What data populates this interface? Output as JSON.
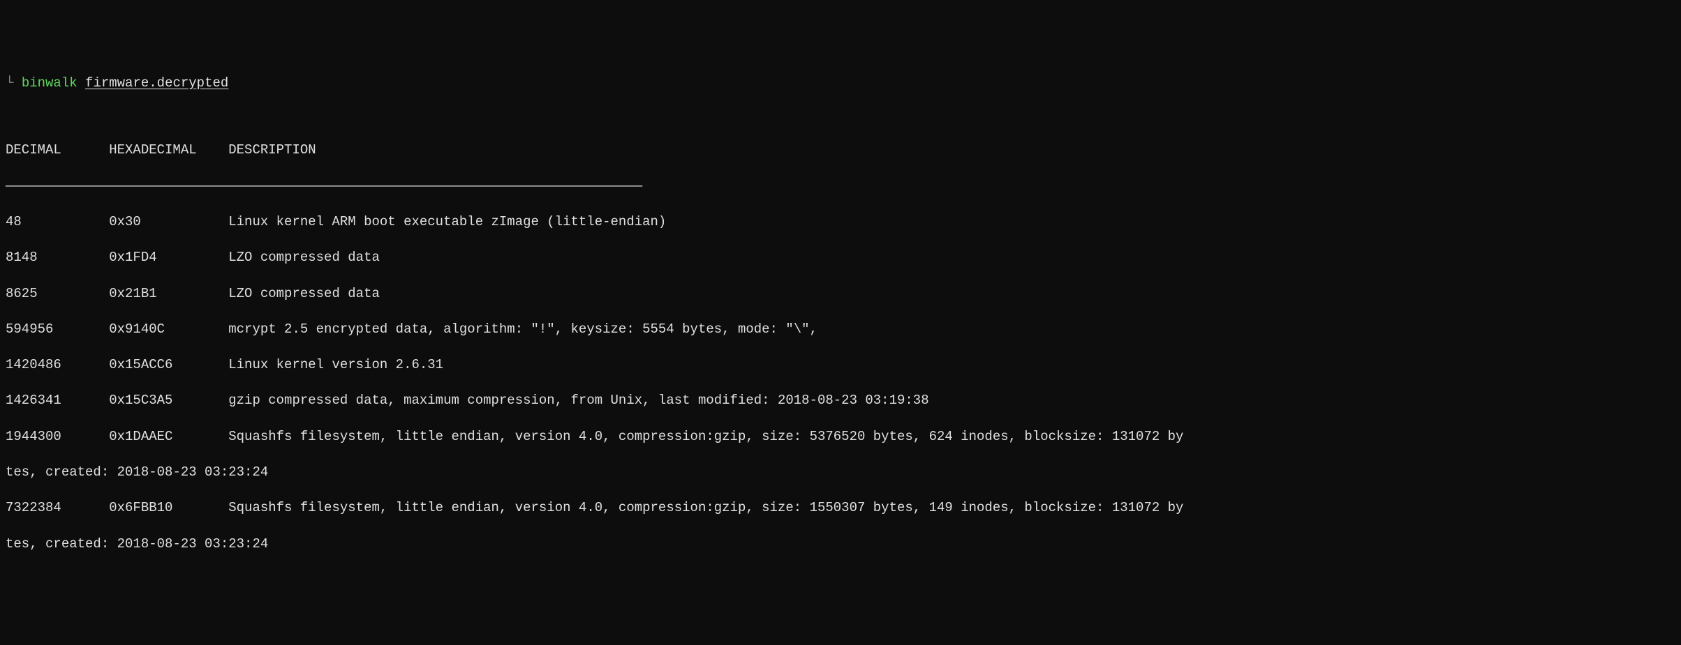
{
  "prompt": {
    "char": "└",
    "command": "binwalk",
    "argument": "firmware.decrypted"
  },
  "headers": {
    "decimal": "DECIMAL",
    "hexadecimal": "HEXADECIMAL",
    "description": "DESCRIPTION"
  },
  "separator": "————————————————————————————————————————————————————————————————————————————————",
  "rows": [
    {
      "decimal": "48",
      "hex": "0x30",
      "description": "Linux kernel ARM boot executable zImage (little-endian)"
    },
    {
      "decimal": "8148",
      "hex": "0x1FD4",
      "description": "LZO compressed data"
    },
    {
      "decimal": "8625",
      "hex": "0x21B1",
      "description": "LZO compressed data"
    },
    {
      "decimal": "594956",
      "hex": "0x9140C",
      "description": "mcrypt 2.5 encrypted data, algorithm: \"!\", keysize: 5554 bytes, mode: \"\\\","
    },
    {
      "decimal": "1420486",
      "hex": "0x15ACC6",
      "description": "Linux kernel version 2.6.31"
    },
    {
      "decimal": "1426341",
      "hex": "0x15C3A5",
      "description": "gzip compressed data, maximum compression, from Unix, last modified: 2018-08-23 03:19:38"
    },
    {
      "decimal": "1944300",
      "hex": "0x1DAAEC",
      "description": "Squashfs filesystem, little endian, version 4.0, compression:gzip, size: 5376520 bytes, 624 inodes, blocksize: 131072 by",
      "continuation": "tes, created: 2018-08-23 03:23:24"
    },
    {
      "decimal": "7322384",
      "hex": "0x6FBB10",
      "description": "Squashfs filesystem, little endian, version 4.0, compression:gzip, size: 1550307 bytes, 149 inodes, blocksize: 131072 by",
      "continuation": "tes, created: 2018-08-23 03:23:24"
    }
  ]
}
